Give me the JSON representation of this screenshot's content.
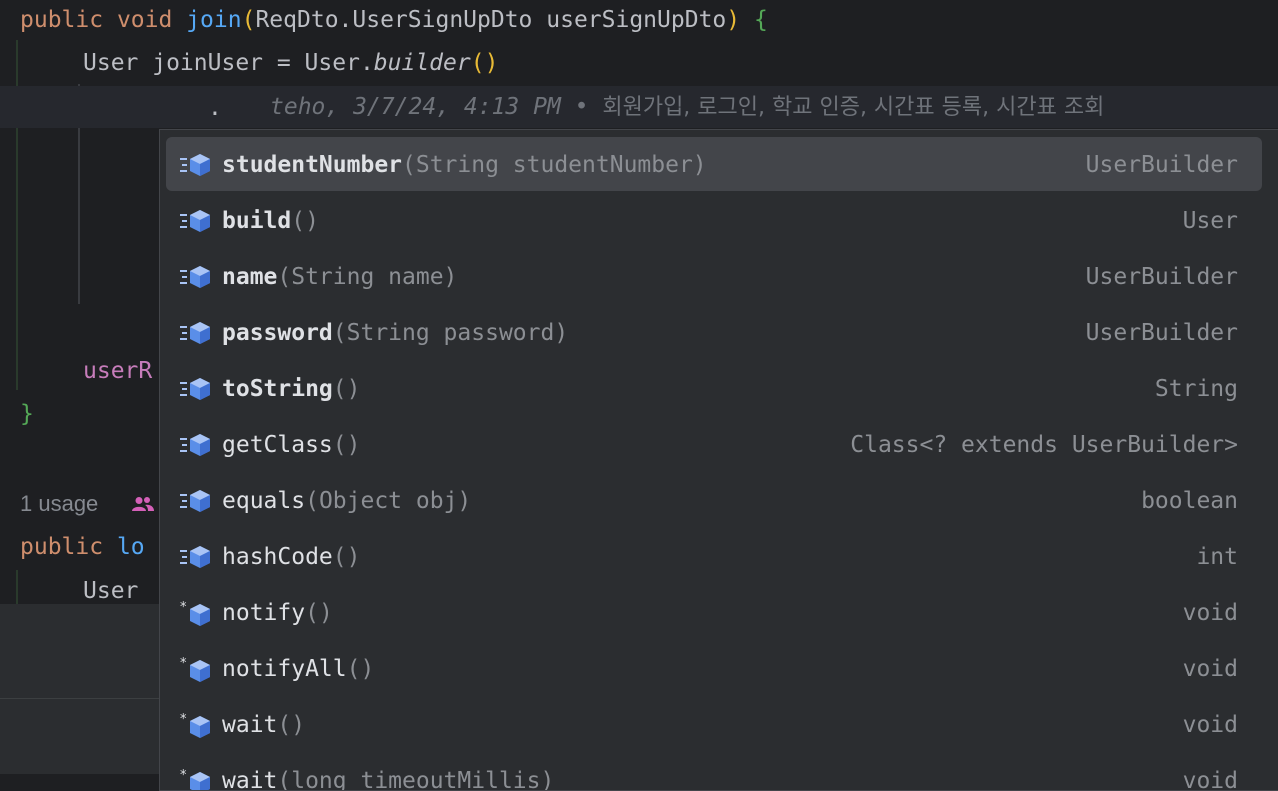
{
  "editor": {
    "line1": {
      "kw1": "public",
      "kw2": "void",
      "fn": "join",
      "open": "(",
      "params": "ReqDto.UserSignUpDto userSignUpDto",
      "close": ")",
      "brace": "{"
    },
    "line2": {
      "decl": "User joinUser = User.",
      "method": "builder",
      "parens": "()"
    },
    "line3": {
      "dot": "."
    },
    "inlay": {
      "meta": "teho, 3/7/24, 4:13 PM • ",
      "message": "회원가입, 로그인, 학교 인증, 시간표 등록, 시간표 조회"
    },
    "line_user_repo": {
      "text": "userR"
    },
    "line_close": {
      "brace": "}"
    },
    "usage": {
      "text": "1 usage"
    },
    "line_public_lo": {
      "kw": "public",
      "text": " lo"
    },
    "line_user": {
      "text": "User"
    }
  },
  "completion": {
    "items": [
      {
        "name": "studentNumber",
        "params": "(String studentNumber)",
        "type": "UserBuilder",
        "icon": "method-icon",
        "bold": true,
        "selected": true
      },
      {
        "name": "build",
        "params": "()",
        "type": "User",
        "icon": "method-icon",
        "bold": true
      },
      {
        "name": "name",
        "params": "(String name)",
        "type": "UserBuilder",
        "icon": "method-icon",
        "bold": true
      },
      {
        "name": "password",
        "params": "(String password)",
        "type": "UserBuilder",
        "icon": "method-icon",
        "bold": true
      },
      {
        "name": "toString",
        "params": "()",
        "type": "String",
        "icon": "method-icon",
        "bold": true
      },
      {
        "name": "getClass",
        "params": "()",
        "type": "Class<? extends UserBuilder>",
        "icon": "method-icon",
        "bold": false
      },
      {
        "name": "equals",
        "params": "(Object obj)",
        "type": "boolean",
        "icon": "method-icon",
        "bold": false
      },
      {
        "name": "hashCode",
        "params": "()",
        "type": "int",
        "icon": "method-icon",
        "bold": false
      },
      {
        "name": "notify",
        "params": "()",
        "type": "void",
        "icon": "native-method-icon",
        "bold": false
      },
      {
        "name": "notifyAll",
        "params": "()",
        "type": "void",
        "icon": "native-method-icon",
        "bold": false
      },
      {
        "name": "wait",
        "params": "()",
        "type": "void",
        "icon": "native-method-icon",
        "bold": false
      },
      {
        "name": "wait",
        "params": "(long timeoutMillis)",
        "type": "void",
        "icon": "native-method-icon",
        "bold": false
      }
    ]
  },
  "colors": {
    "background": "#1e1f22",
    "popup": "#2b2d30",
    "selected": "#43454a",
    "keyword": "#cf8e6d",
    "function": "#56a8f5",
    "field": "#c77dbb",
    "icon_blue": "#5a8ee8",
    "icon_light": "#a9c4f5"
  }
}
